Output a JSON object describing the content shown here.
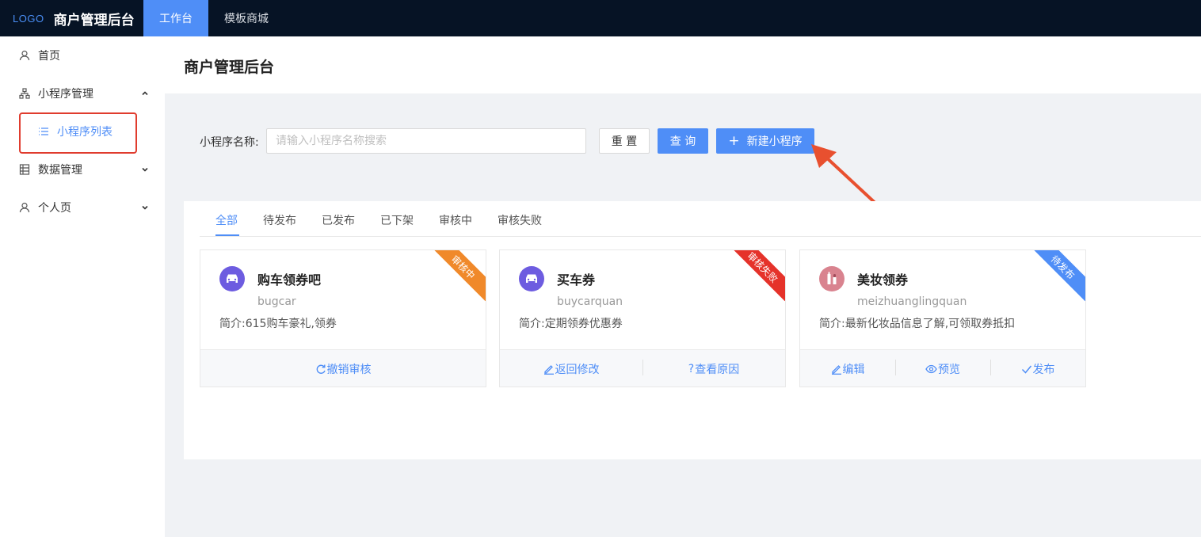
{
  "topbar": {
    "logo": "LOGO",
    "title": "商户管理后台",
    "tabs": [
      {
        "label": "工作台",
        "active": true
      },
      {
        "label": "模板商城",
        "active": false
      }
    ]
  },
  "sidebar": {
    "items": [
      {
        "label": "首页",
        "icon": "user-icon"
      },
      {
        "label": "小程序管理",
        "icon": "org-chart-icon",
        "expanded": true
      },
      {
        "label": "小程序列表",
        "icon": "list-icon",
        "active": true
      },
      {
        "label": "数据管理",
        "icon": "table-icon"
      },
      {
        "label": "个人页",
        "icon": "user-icon"
      }
    ]
  },
  "page": {
    "title": "商户管理后台"
  },
  "search": {
    "label": "小程序名称:",
    "placeholder": "请输入小程序名称搜索",
    "reset_label": "重 置",
    "query_label": "查 询",
    "new_label": "新建小程序"
  },
  "tabs": [
    {
      "label": "全部",
      "active": true
    },
    {
      "label": "待发布"
    },
    {
      "label": "已发布"
    },
    {
      "label": "已下架"
    },
    {
      "label": "审核中"
    },
    {
      "label": "审核失败"
    }
  ],
  "cards": [
    {
      "name": "购车领券吧",
      "code": "bugcar",
      "desc": "简介:615购车豪礼,领券",
      "status": "审核中",
      "status_color": "#f0892a",
      "avatar_color": "#6d5ce0",
      "icon": "car-icon",
      "actions": [
        {
          "label": "撤销审核",
          "icon": "refresh-icon"
        }
      ]
    },
    {
      "name": "买车券",
      "code": "buycarquan",
      "desc": "简介:定期领券优惠券",
      "status": "审核失败",
      "status_color": "#e5322a",
      "avatar_color": "#6d5ce0",
      "icon": "car-icon",
      "actions": [
        {
          "label": "返回修改",
          "icon": "edit-icon"
        },
        {
          "label": "查看原因",
          "icon": "question-icon"
        }
      ]
    },
    {
      "name": "美妆领券",
      "code": "meizhuanglingquan",
      "desc": "简介:最新化妆品信息了解,可领取券抵扣",
      "status": "待发布",
      "status_color": "#4f8ef7",
      "avatar_color": "#d9838f",
      "icon": "cosmetics-icon",
      "actions": [
        {
          "label": "编辑",
          "icon": "edit-icon"
        },
        {
          "label": "预览",
          "icon": "eye-icon"
        },
        {
          "label": "发布",
          "icon": "check-icon"
        }
      ]
    }
  ],
  "colors": {
    "primary": "#4f8ef7",
    "topbar_bg": "#061325",
    "annotation": "#e8502f"
  }
}
